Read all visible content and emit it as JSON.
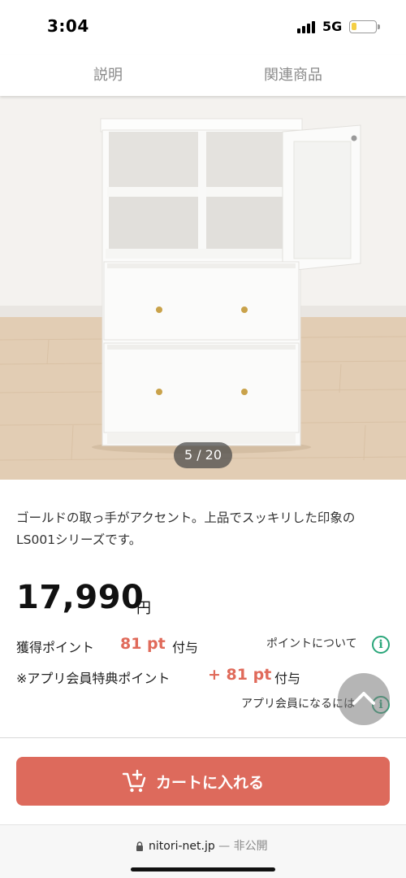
{
  "status_bar": {
    "time": "3:04",
    "network": "5G",
    "battery_level": 0.2
  },
  "tabs": [
    {
      "label": "説明"
    },
    {
      "label": "関連商品"
    }
  ],
  "gallery": {
    "current": 5,
    "total": 20,
    "counter": "5 / 20"
  },
  "product": {
    "description": "ゴールドの取っ手がアクセント。上品でスッキリした印象のLS001シリーズです。",
    "price": "17,990",
    "price_unit": "円"
  },
  "points": {
    "earn_label": "獲得ポイント",
    "earn_value": "81 pt",
    "earn_suffix": "付与",
    "about_link": "ポイントについて",
    "app_label": "※アプリ会員特典ポイント",
    "app_value": "+ 81 pt",
    "app_suffix": "付与",
    "become_member_link": "アプリ会員になるには"
  },
  "cart": {
    "label": "カートに入れる"
  },
  "url_bar": {
    "domain": "nitori-net.jp",
    "privacy": "— 非公開"
  },
  "colors": {
    "accent": "#dd6a5c",
    "point_red": "#e06a5a",
    "info_green": "#2aa67a"
  },
  "icons": [
    "signal-icon",
    "battery-icon",
    "info-icon",
    "chevron-up-icon",
    "cart-add-icon",
    "lock-icon"
  ]
}
